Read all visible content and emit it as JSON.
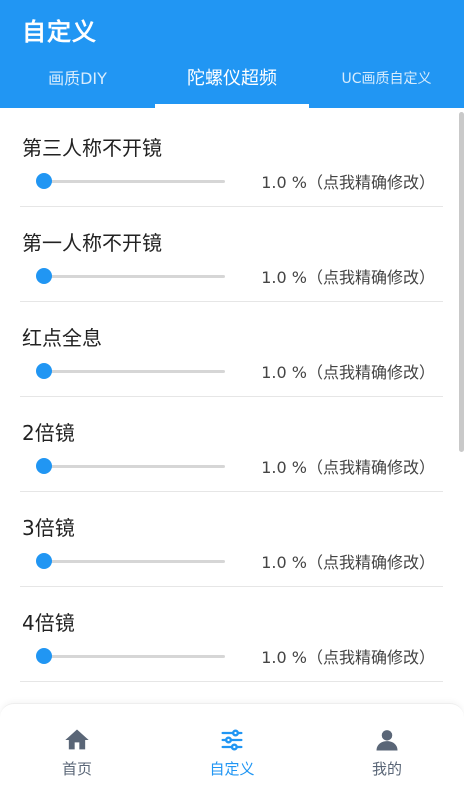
{
  "header": {
    "title": "自定义"
  },
  "tabs": [
    {
      "label": "画质DIY"
    },
    {
      "label": "陀螺仪超频"
    },
    {
      "label": "UC画质自定义"
    }
  ],
  "active_tab": "陀螺仪超频",
  "settings": [
    {
      "label": "第三人称不开镜",
      "value": "1.0 %（点我精确修改）",
      "level": 1.0
    },
    {
      "label": "第一人称不开镜",
      "value": "1.0 %（点我精确修改）",
      "level": 1.0
    },
    {
      "label": "红点全息",
      "value": "1.0 %（点我精确修改）",
      "level": 1.0
    },
    {
      "label": "2倍镜",
      "value": "1.0 %（点我精确修改）",
      "level": 1.0
    },
    {
      "label": "3倍镜",
      "value": "1.0 %（点我精确修改）",
      "level": 1.0
    },
    {
      "label": "4倍镜",
      "value": "1.0 %（点我精确修改）",
      "level": 1.0
    }
  ],
  "bottom_nav": [
    {
      "label": "首页",
      "icon": "home-icon"
    },
    {
      "label": "自定义",
      "icon": "sliders-icon"
    },
    {
      "label": "我的",
      "icon": "user-icon"
    }
  ],
  "colors": {
    "accent": "#2196f3",
    "track": "#d6d6d6",
    "nav_inactive": "#5a6677"
  }
}
